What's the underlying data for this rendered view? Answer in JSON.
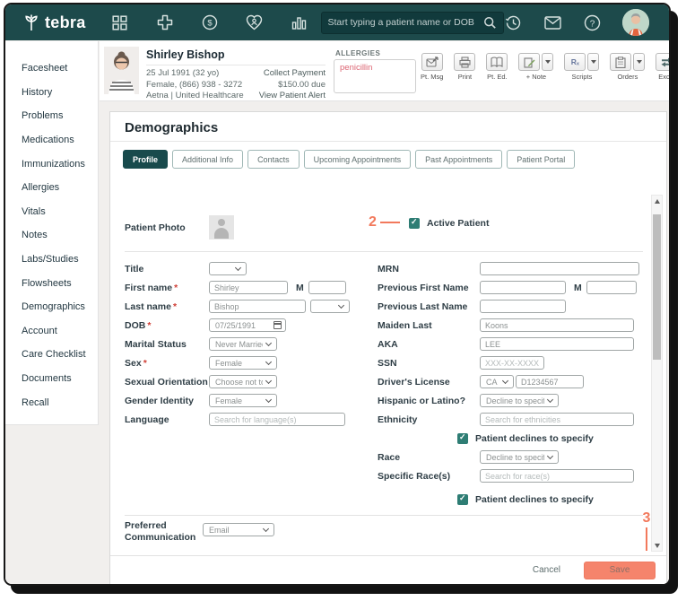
{
  "colors": {
    "brand_teal": "#1d4a4b",
    "accent_coral": "#f2795c",
    "checkbox_teal": "#2e7d74",
    "allergy_red": "#dc6472",
    "save_coral": "#f5846c"
  },
  "navbar": {
    "logo_text": "tebra",
    "search_placeholder": "Start typing a patient name or DOB"
  },
  "patient_header": {
    "name": "Shirley Bishop",
    "dob": "25 Jul 1991 (32 yo)",
    "sex_phone": "Female, (866) 938 - 3272",
    "insurance": "Aetna | United Healthcare",
    "collect_payment": "Collect Payment",
    "amount_due": "$150.00 due",
    "view_patient_alert": "View Patient Alert",
    "allergies_label": "ALLERGIES",
    "allergies_value": "penicillin",
    "actions": [
      {
        "label": "Pt. Msg"
      },
      {
        "label": "Print"
      },
      {
        "label": "Pt. Ed."
      },
      {
        "label": "+ Note"
      },
      {
        "label": "Scripts"
      },
      {
        "label": "Orders"
      },
      {
        "label": "Exchange"
      }
    ]
  },
  "sidebar": {
    "items": [
      "Facesheet",
      "History",
      "Problems",
      "Medications",
      "Immunizations",
      "Allergies",
      "Vitals",
      "Notes",
      "Labs/Studies",
      "Flowsheets",
      "Demographics",
      "Account",
      "Care Checklist",
      "Documents",
      "Recall"
    ]
  },
  "page": {
    "title": "Demographics",
    "tabs": [
      {
        "label": "Profile"
      },
      {
        "label": "Additional Info"
      },
      {
        "label": "Contacts"
      },
      {
        "label": "Upcoming Appointments"
      },
      {
        "label": "Past Appointments"
      },
      {
        "label": "Patient Portal"
      }
    ]
  },
  "form": {
    "required_mark": "*",
    "patient_photo_label": "Patient Photo",
    "active_patient_label": "Active Patient",
    "declines_label": "Patient declines to specify",
    "title": {
      "label": "Title"
    },
    "first_name": {
      "label": "First name",
      "value": "Shirley",
      "middle_label": "M"
    },
    "last_name": {
      "label": "Last name",
      "value": "Bishop"
    },
    "dob": {
      "label": "DOB",
      "value": "07/25/1991"
    },
    "marital_status": {
      "label": "Marital Status",
      "value": "Never Married"
    },
    "sex": {
      "label": "Sex",
      "value": "Female"
    },
    "sexual_orientation": {
      "label": "Sexual Orientation",
      "value": "Choose not to dis..."
    },
    "gender_identity": {
      "label": "Gender Identity",
      "value": "Female"
    },
    "language": {
      "label": "Language",
      "placeholder": "Search for language(s)"
    },
    "mrn": {
      "label": "MRN"
    },
    "previous_first_name": {
      "label": "Previous First Name",
      "middle_label": "M"
    },
    "previous_last_name": {
      "label": "Previous Last Name"
    },
    "maiden_last": {
      "label": "Maiden Last",
      "value": "Koons"
    },
    "aka": {
      "label": "AKA",
      "value": "LEE"
    },
    "ssn": {
      "label": "SSN",
      "placeholder": "XXX-XX-XXXX"
    },
    "drivers_license": {
      "label": "Driver's License",
      "state": "CA",
      "value": "D1234567"
    },
    "hispanic": {
      "label": "Hispanic or Latino?",
      "value": "Decline to specify"
    },
    "ethnicity": {
      "label": "Ethnicity",
      "placeholder": "Search for ethnicities"
    },
    "race": {
      "label": "Race",
      "value": "Decline to specify"
    },
    "specific_races": {
      "label": "Specific Race(s)",
      "placeholder": "Search for race(s)"
    },
    "preferred_communication": {
      "label": "Preferred Communication",
      "value": "Email"
    }
  },
  "footer": {
    "cancel_label": "Cancel",
    "save_label": "Save"
  },
  "annotations": {
    "step2": "2",
    "step3": "3"
  }
}
